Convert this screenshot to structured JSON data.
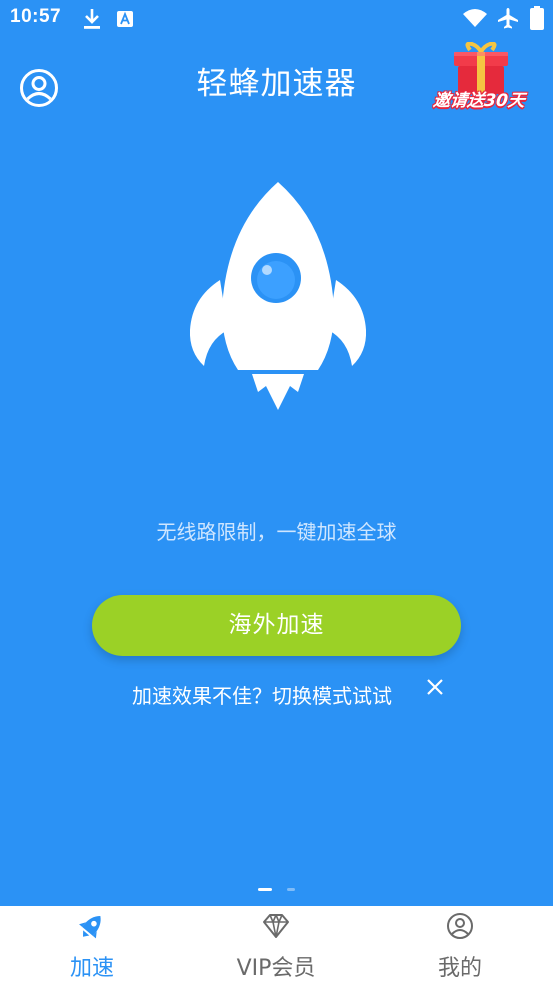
{
  "status_bar": {
    "time": "10:57",
    "icons": [
      "download-icon",
      "text-a-icon",
      "wifi-icon",
      "airplane-icon",
      "battery-icon"
    ]
  },
  "header": {
    "title": "轻蜂加速器",
    "profile_icon": "user-circle-icon",
    "invite_label": "邀请送30天",
    "invite_icon": "gift-box-icon"
  },
  "main": {
    "hero_icon": "rocket-icon",
    "tagline": "无线路限制，一键加速全球",
    "accelerate_button": "海外加速",
    "switch_tip": "加速效果不佳？切换模式试试",
    "close_icon": "close-icon",
    "pager": {
      "pages": 2,
      "active": 1
    }
  },
  "bottom_nav": {
    "items": [
      {
        "label": "加速",
        "icon": "rocket-icon",
        "active": true
      },
      {
        "label": "VIP会员",
        "icon": "diamond-icon",
        "active": false
      },
      {
        "label": "我的",
        "icon": "user-circle-icon",
        "active": false
      }
    ]
  },
  "colors": {
    "background": "#2b92f5",
    "accent_green": "#9bd126",
    "active_tab": "#2b92f5",
    "inactive_tab": "#6a6a6a",
    "invite_red": "#e8263c"
  }
}
